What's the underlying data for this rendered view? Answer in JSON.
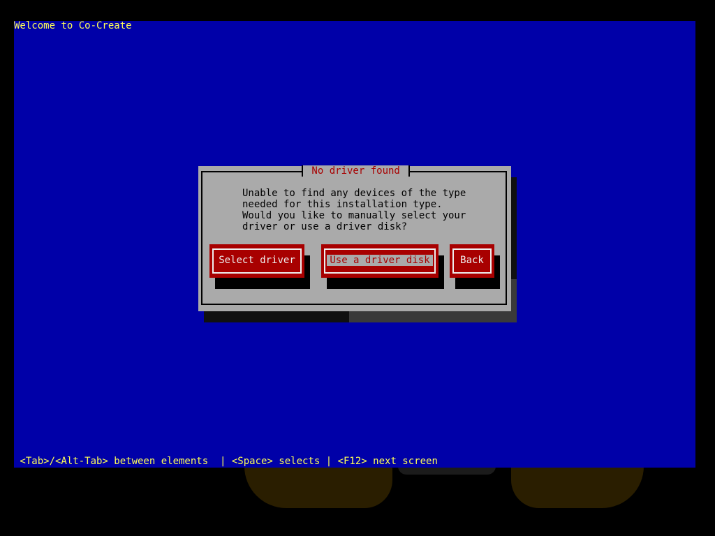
{
  "screen": {
    "title": "Welcome to Co-Create",
    "help_line": " <Tab>/<Alt-Tab> between elements  | <Space> selects | <F12> next screen"
  },
  "dialog": {
    "title": " No driver found ",
    "message": "Unable to find any devices of the type\nneeded for this installation type.\nWould you like to manually select your\ndriver or use a driver disk?",
    "buttons": {
      "select_driver": "Select driver",
      "driver_disk": "Use a driver disk",
      "back": "Back"
    }
  },
  "colors": {
    "background": "#0000a8",
    "title_text": "#ffff55",
    "dialog_bg": "#aaaaaa",
    "dialog_title": "#a80000",
    "button_bg": "#a80000",
    "button_text": "#eeeeee"
  },
  "state": {
    "focused_button": "driver_disk"
  }
}
